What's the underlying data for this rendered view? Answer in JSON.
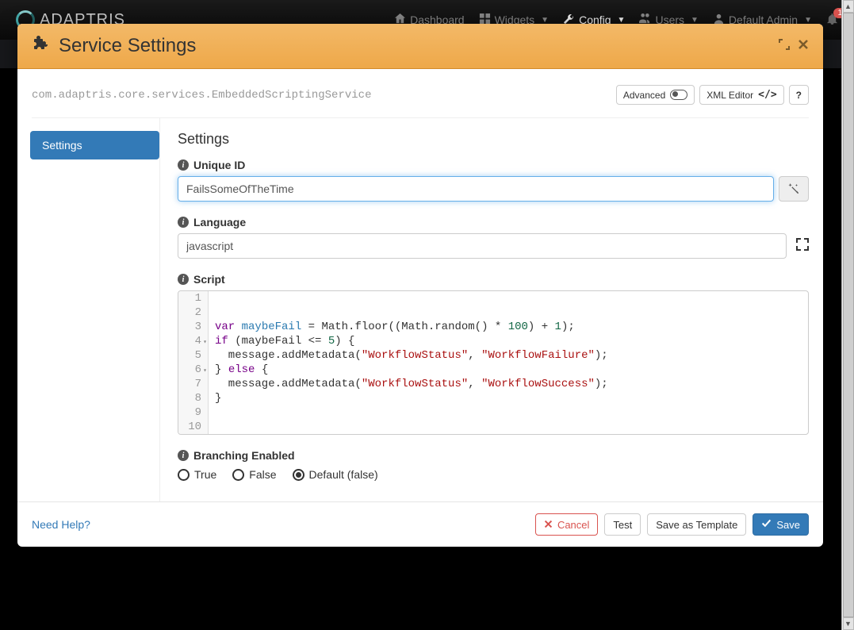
{
  "topnav": {
    "brand": "ADAPTRIS",
    "items": [
      {
        "label": "Dashboard",
        "icon": "home-icon"
      },
      {
        "label": "Widgets",
        "icon": "widgets-icon",
        "caret": true
      },
      {
        "label": "Config",
        "icon": "wrench-icon",
        "caret": true,
        "active": true
      },
      {
        "label": "Users",
        "icon": "users-icon",
        "caret": true
      },
      {
        "label": "Default Admin",
        "icon": "user-icon",
        "caret": true
      }
    ],
    "bell_count": "1"
  },
  "modal": {
    "title": "Service Settings",
    "classpath": "com.adaptris.core.services.EmbeddedScriptingService",
    "header_buttons": {
      "advanced": "Advanced",
      "xml": "XML Editor",
      "help": "?"
    },
    "tabs": {
      "settings": "Settings"
    },
    "panel_title": "Settings",
    "fields": {
      "unique_id": {
        "label": "Unique ID",
        "value": "FailsSomeOfTheTime"
      },
      "language": {
        "label": "Language",
        "value": "javascript"
      },
      "script": {
        "label": "Script"
      },
      "branching": {
        "label": "Branching Enabled",
        "opts": {
          "t": "True",
          "f": "False",
          "d": "Default (false)"
        },
        "selected": "d"
      }
    },
    "code": {
      "l1": "",
      "l2": "",
      "l3_a": "var",
      "l3_b": " ",
      "l3_c": "maybeFail",
      "l3_d": " = Math.floor((Math.random() * ",
      "l3_e": "100",
      "l3_f": ") + ",
      "l3_g": "1",
      "l3_h": ");",
      "l4_a": "if",
      "l4_b": " (maybeFail <= ",
      "l4_c": "5",
      "l4_d": ") {",
      "l5_a": "  message.addMetadata(",
      "l5_b": "\"WorkflowStatus\"",
      "l5_c": ", ",
      "l5_d": "\"WorkflowFailure\"",
      "l5_e": ");",
      "l6_a": "} ",
      "l6_b": "else",
      "l6_c": " {",
      "l7_a": "  message.addMetadata(",
      "l7_b": "\"WorkflowStatus\"",
      "l7_c": ", ",
      "l7_d": "\"WorkflowSuccess\"",
      "l7_e": ");",
      "l8": "}",
      "l9": "",
      "l10": ""
    },
    "footer": {
      "help": "Need Help?",
      "cancel": "Cancel",
      "test": "Test",
      "save_template": "Save as Template",
      "save": "Save"
    }
  }
}
